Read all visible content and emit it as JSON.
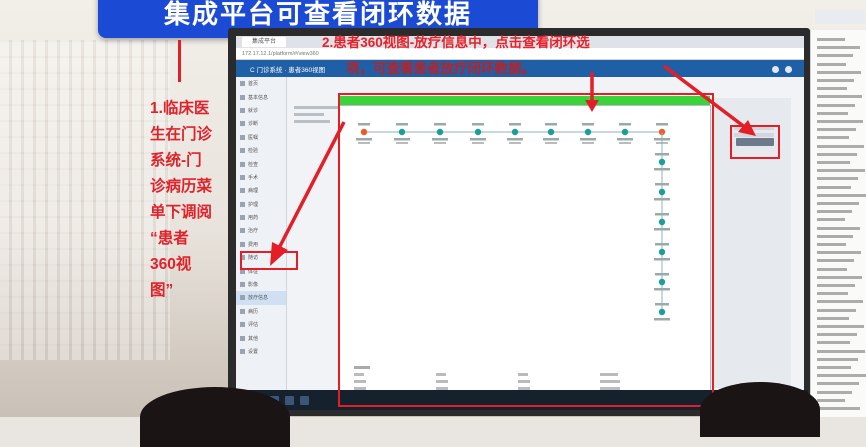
{
  "slide": {
    "title": "集成平台可查看闭环数据",
    "step1_lines": [
      "1.临床医",
      "生在门诊",
      "系统-门",
      "诊病历菜",
      "单下调阅",
      "“患者",
      "360视",
      "图”"
    ],
    "step2_line1": "2.患者360视图-放疗信息中，点击查看闭环选",
    "step2_line2": "项，可查看患者放疗闭环数据。"
  },
  "browser": {
    "tab_label": "集成平台",
    "url": "172.17.12.1/platform/#/view360",
    "app_title": "C 门诊系统 · 患者360视图"
  },
  "sidebar": {
    "items": [
      "首页",
      "基本信息",
      "就诊",
      "诊断",
      "医嘱",
      "检验",
      "检查",
      "手术",
      "病理",
      "护理",
      "用药",
      "治疗",
      "费用",
      "随访",
      "体征",
      "影像",
      "放疗信息",
      "病历",
      "评估",
      "其他",
      "设置"
    ]
  },
  "colors": {
    "accent_blue": "#1b4ad4",
    "annotation_red": "#e41e26",
    "modal_green": "#3bd33b",
    "node_teal": "#1a9e9a",
    "node_orange": "#f05a24"
  },
  "icons": {
    "arrow": "red-arrow",
    "node": "flow-node-icon"
  }
}
